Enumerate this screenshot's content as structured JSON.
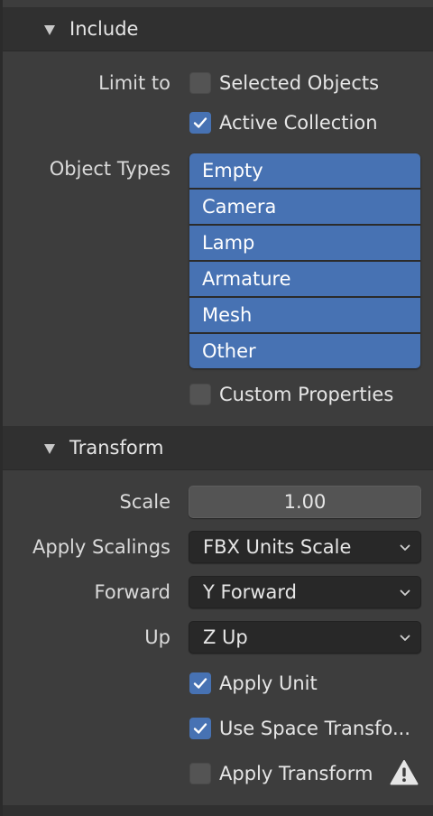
{
  "include": {
    "header": "Include",
    "limit_to_label": "Limit to",
    "selected_objects": {
      "label": "Selected Objects",
      "checked": false
    },
    "active_collection": {
      "label": "Active Collection",
      "checked": true
    },
    "object_types_label": "Object Types",
    "object_types": [
      "Empty",
      "Camera",
      "Lamp",
      "Armature",
      "Mesh",
      "Other"
    ],
    "custom_properties": {
      "label": "Custom Properties",
      "checked": false
    }
  },
  "transform": {
    "header": "Transform",
    "scale_label": "Scale",
    "scale_value": "1.00",
    "apply_scalings_label": "Apply Scalings",
    "apply_scalings_value": "FBX Units Scale",
    "forward_label": "Forward",
    "forward_value": "Y Forward",
    "up_label": "Up",
    "up_value": "Z Up",
    "apply_unit": {
      "label": "Apply Unit",
      "checked": true
    },
    "use_space_transform": {
      "label": "Use Space Transfo...",
      "checked": true
    },
    "apply_transform": {
      "label": "Apply Transform",
      "checked": false
    }
  },
  "colors": {
    "accent": "#4772b3",
    "background": "#3d3d3d",
    "header_bg": "#303030"
  },
  "icons": {
    "warning": "warning-icon",
    "collapse": "triangle-down-icon",
    "dropdown": "chevron-down-icon"
  }
}
